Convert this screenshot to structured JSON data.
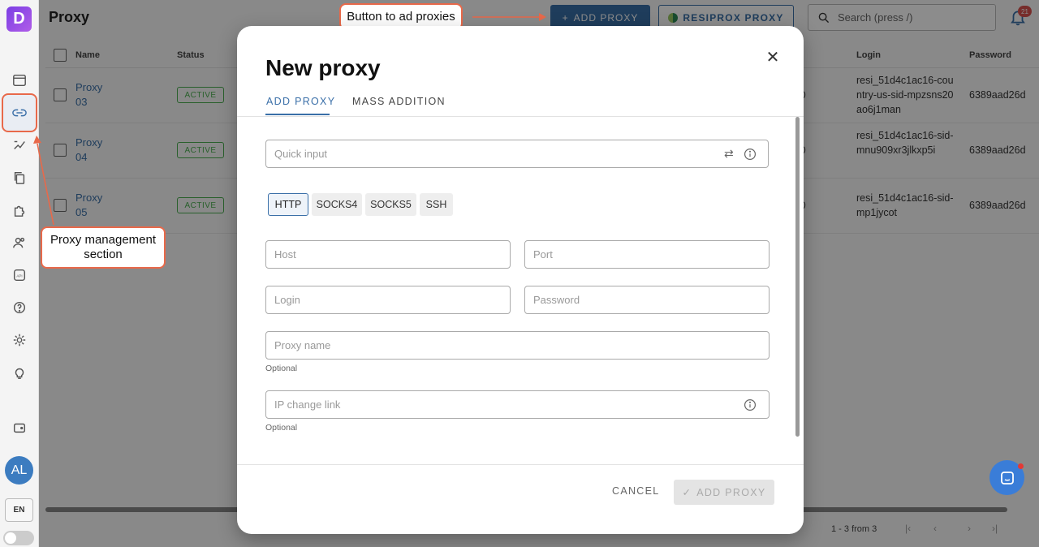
{
  "app": {
    "logo_letter": "D",
    "page_title": "Proxy",
    "add_proxy_label": "ADD PROXY",
    "resiprox_label": "RESIPROX PROXY",
    "search_placeholder": "Search (press /)",
    "notifications_count": "21",
    "avatar_initials": "AL",
    "language": "EN"
  },
  "annotations": {
    "button_note": "Button to ad proxies",
    "section_note_line1": "Proxy management",
    "section_note_line2": "section"
  },
  "table": {
    "headers": {
      "name": "Name",
      "status": "Status",
      "login": "Login",
      "password": "Password"
    },
    "rows": [
      {
        "name_line1": "Proxy",
        "name_line2": "03",
        "status": "ACTIVE",
        "num": "0",
        "login": "resi_51d4c1ac16-country-us-sid-mpzsns20ao6j1man",
        "password": "6389aad26d"
      },
      {
        "name_line1": "Proxy",
        "name_line2": "04",
        "status": "ACTIVE",
        "num": "0",
        "login": "resi_51d4c1ac16-sid-mnu909xr3jlkxp5i",
        "password": "6389aad26d"
      },
      {
        "name_line1": "Proxy",
        "name_line2": "05",
        "status": "ACTIVE",
        "num": "0",
        "login": "resi_51d4c1ac16-sid-mp1jycot",
        "password": "6389aad26d"
      }
    ],
    "pagination": "1 - 3 from 3"
  },
  "modal": {
    "title": "New proxy",
    "tabs": [
      "ADD PROXY",
      "MASS ADDITION"
    ],
    "quick_input_placeholder": "Quick input",
    "protocols": [
      "HTTP",
      "SOCKS4",
      "SOCKS5",
      "SSH"
    ],
    "selected_protocol": "HTTP",
    "host_placeholder": "Host",
    "port_placeholder": "Port",
    "login_placeholder": "Login",
    "password_placeholder": "Password",
    "proxy_name_placeholder": "Proxy name",
    "proxy_name_helper": "Optional",
    "ip_change_placeholder": "IP change link",
    "ip_change_helper": "Optional",
    "cancel_label": "CANCEL",
    "submit_label": "ADD PROXY"
  },
  "colors": {
    "accent": "#3a6fa8",
    "annotation": "#e8694a",
    "active_status": "#4caf50"
  }
}
